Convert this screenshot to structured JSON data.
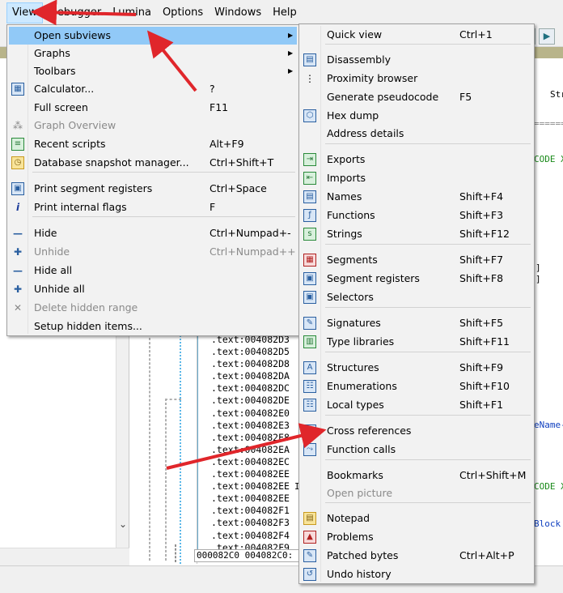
{
  "menubar": {
    "items": [
      "View",
      "Debugger",
      "Lumina",
      "Options",
      "Windows",
      "Help"
    ]
  },
  "background": {
    "code_lines": [
      ".text:004082D3",
      ".text:004082D5",
      ".text:004082D8",
      ".text:004082DA",
      ".text:004082DC",
      ".text:004082DE",
      ".text:004082E0",
      ".text:004082E3",
      ".text:004082E8",
      ".text:004082EA",
      ".text:004082EC",
      ".text:004082EE",
      ".text:004082EE",
      ".text:004082EE",
      ".text:004082F1",
      ".text:004082F3",
      ".text:004082F4",
      ".text:004082F9"
    ],
    "status_line": "000082C0 004082C0:",
    "fragments": {
      "tab_str": "Str",
      "dashes": "=======",
      "code_x1": "CODE X",
      "bracket1": "]",
      "bracket2": "]",
      "name_frag": "eName-",
      "code_x2": "CODE X",
      "block_frag": "Block",
      "bottom_i": "I"
    }
  },
  "view_menu": {
    "items": [
      {
        "label": "Open subviews",
        "shortcut": "",
        "icon": "none",
        "submenu": true,
        "highlight": true
      },
      {
        "label": "Graphs",
        "shortcut": "",
        "icon": "none",
        "submenu": true
      },
      {
        "label": "Toolbars",
        "shortcut": "",
        "icon": "none",
        "submenu": true
      },
      {
        "label": "Calculator...",
        "shortcut": "?",
        "icon": "calculator-icon"
      },
      {
        "label": "Full screen",
        "shortcut": "F11",
        "icon": "none"
      },
      {
        "label": "Graph Overview",
        "shortcut": "",
        "icon": "graph-overview-icon",
        "disabled": true
      },
      {
        "label": "Recent scripts",
        "shortcut": "Alt+F9",
        "icon": "recent-scripts-icon"
      },
      {
        "label": "Database snapshot manager...",
        "shortcut": "Ctrl+Shift+T",
        "icon": "snapshot-icon"
      },
      {
        "label": "Print segment registers",
        "shortcut": "Ctrl+Space",
        "icon": "segment-registers-icon"
      },
      {
        "label": "Print internal flags",
        "shortcut": "F",
        "icon": "info-icon"
      },
      {
        "label": "Hide",
        "shortcut": "Ctrl+Numpad+-",
        "icon": "minus-icon"
      },
      {
        "label": "Unhide",
        "shortcut": "Ctrl+Numpad++",
        "icon": "plus-icon",
        "disabled": true
      },
      {
        "label": "Hide all",
        "shortcut": "",
        "icon": "minus-icon"
      },
      {
        "label": "Unhide all",
        "shortcut": "",
        "icon": "plus-icon"
      },
      {
        "label": "Delete hidden range",
        "shortcut": "",
        "icon": "delete-icon",
        "disabled": true
      },
      {
        "label": "Setup hidden items...",
        "shortcut": "",
        "icon": "none"
      }
    ]
  },
  "subviews_menu": {
    "items": [
      {
        "label": "Quick view",
        "shortcut": "Ctrl+1"
      },
      {
        "label": "Disassembly",
        "shortcut": ""
      },
      {
        "label": "Proximity browser",
        "shortcut": ""
      },
      {
        "label": "Generate pseudocode",
        "shortcut": "F5"
      },
      {
        "label": "Hex dump",
        "shortcut": ""
      },
      {
        "label": "Address details",
        "shortcut": ""
      },
      {
        "label": "Exports",
        "shortcut": ""
      },
      {
        "label": "Imports",
        "shortcut": ""
      },
      {
        "label": "Names",
        "shortcut": "Shift+F4"
      },
      {
        "label": "Functions",
        "shortcut": "Shift+F3"
      },
      {
        "label": "Strings",
        "shortcut": "Shift+F12"
      },
      {
        "label": "Segments",
        "shortcut": "Shift+F7"
      },
      {
        "label": "Segment registers",
        "shortcut": "Shift+F8"
      },
      {
        "label": "Selectors",
        "shortcut": ""
      },
      {
        "label": "Signatures",
        "shortcut": "Shift+F5"
      },
      {
        "label": "Type libraries",
        "shortcut": "Shift+F11"
      },
      {
        "label": "Structures",
        "shortcut": "Shift+F9"
      },
      {
        "label": "Enumerations",
        "shortcut": "Shift+F10"
      },
      {
        "label": "Local types",
        "shortcut": "Shift+F1"
      },
      {
        "label": "Cross references",
        "shortcut": ""
      },
      {
        "label": "Function calls",
        "shortcut": ""
      },
      {
        "label": "Bookmarks",
        "shortcut": "Ctrl+Shift+M"
      },
      {
        "label": "Open picture",
        "shortcut": ""
      },
      {
        "label": "Notepad",
        "shortcut": ""
      },
      {
        "label": "Problems",
        "shortcut": ""
      },
      {
        "label": "Patched bytes",
        "shortcut": "Ctrl+Alt+P"
      },
      {
        "label": "Undo history",
        "shortcut": ""
      }
    ]
  },
  "colors": {
    "highlight": "#91c9f7",
    "annotation_arrow": "#e0262b"
  }
}
